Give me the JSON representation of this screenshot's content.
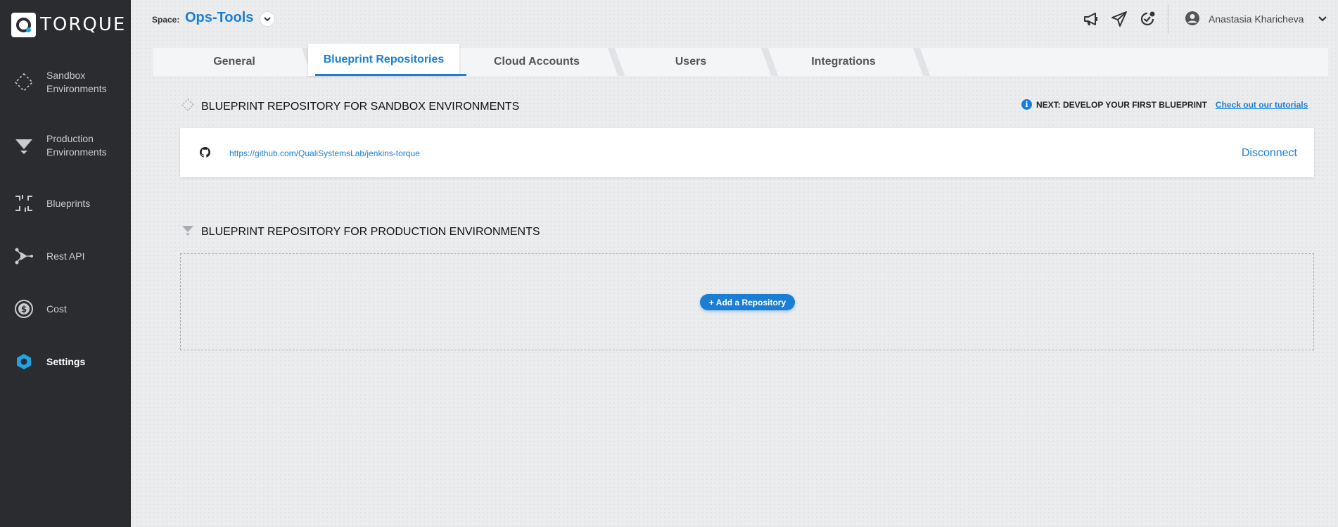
{
  "brand": {
    "name": "TORQUE"
  },
  "sidebar": {
    "items": [
      {
        "label": "Sandbox Environments",
        "icon": "sandbox-icon"
      },
      {
        "label": "Production Environments",
        "icon": "production-icon"
      },
      {
        "label": "Blueprints",
        "icon": "blueprints-icon"
      },
      {
        "label": "Rest API",
        "icon": "rest-api-icon"
      },
      {
        "label": "Cost",
        "icon": "cost-icon"
      },
      {
        "label": "Settings",
        "icon": "settings-icon",
        "active": true
      }
    ]
  },
  "topbar": {
    "space_label": "Space:",
    "space_name": "Ops-Tools",
    "user_name": "Anastasia Kharicheva",
    "icons": [
      "megaphone-icon",
      "send-icon",
      "notifications-icon"
    ]
  },
  "tabs": [
    {
      "label": "General"
    },
    {
      "label": "Blueprint Repositories",
      "active": true
    },
    {
      "label": "Cloud Accounts"
    },
    {
      "label": "Users"
    },
    {
      "label": "Integrations"
    }
  ],
  "sandbox_section": {
    "title": "BLUEPRINT REPOSITORY FOR SANDBOX ENVIRONMENTS",
    "next_hint": "NEXT: DEVELOP YOUR FIRST BLUEPRINT",
    "tutorial_link": "Check out our tutorials",
    "repo_url": "https://github.com/QualiSystemsLab/jenkins-torque",
    "disconnect_label": "Disconnect"
  },
  "production_section": {
    "title": "BLUEPRINT REPOSITORY FOR PRODUCTION ENVIRONMENTS",
    "add_label": "+ Add a Repository"
  },
  "colors": {
    "accent": "#1a7fd4",
    "sidebar_bg": "#2b2c2f",
    "page_bg": "#ebecee"
  }
}
